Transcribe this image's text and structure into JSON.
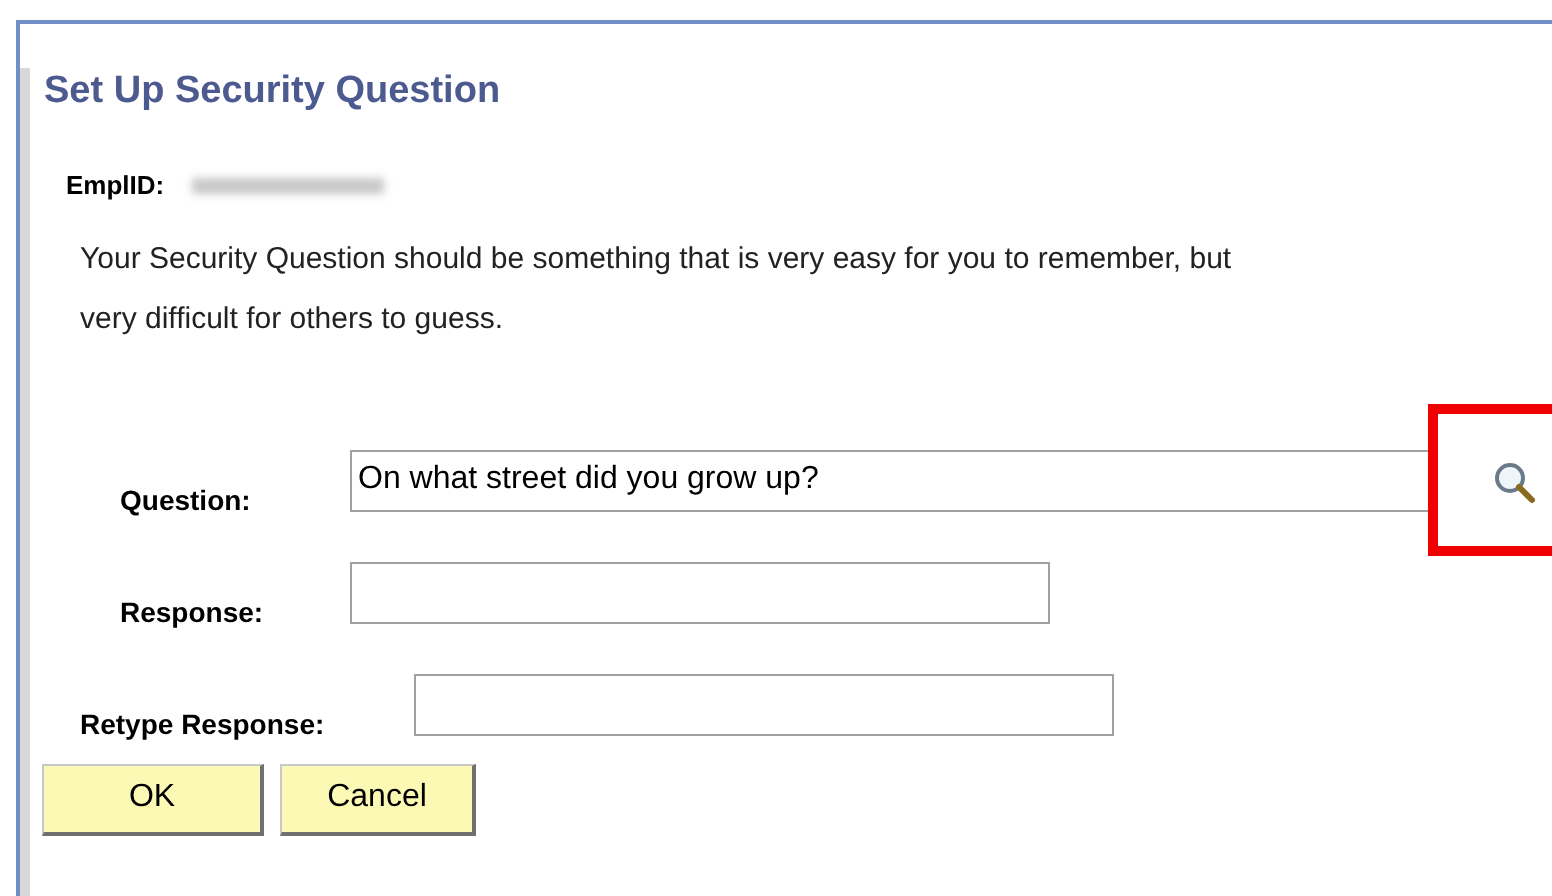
{
  "page": {
    "title": "Set Up Security Question"
  },
  "employee": {
    "label": "EmplID:",
    "value_redacted": true
  },
  "instructions": "Your Security Question should be something that is very easy for you to remember, but very difficult for others to guess.",
  "fields": [
    {
      "kind": "lookup",
      "label": "Question:",
      "value": "On what street did you grow up?"
    },
    {
      "kind": "text",
      "label": "Response:"
    },
    {
      "kind": "text",
      "label": "Retype Response:"
    }
  ],
  "lookup_highlighted": true,
  "buttons": [
    {
      "label": "OK"
    },
    {
      "label": "Cancel"
    }
  ]
}
